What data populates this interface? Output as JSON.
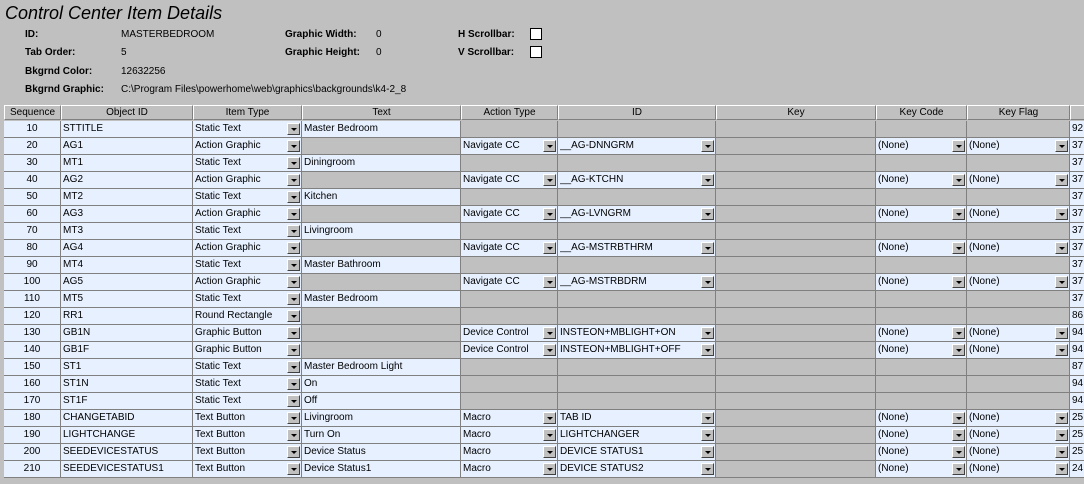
{
  "window": {
    "title": "Control Center Item Details"
  },
  "details": {
    "id_label": "ID:",
    "id_value": "MASTERBEDROOM",
    "tab_order_label": "Tab Order:",
    "tab_order_value": "5",
    "bkgrnd_color_label": "Bkgrnd Color:",
    "bkgrnd_color_value": "12632256",
    "bkgrnd_graphic_label": "Bkgrnd Graphic:",
    "bkgrnd_graphic_value": "C:\\Program Files\\powerhome\\web\\graphics\\backgrounds\\k4-2_8",
    "graphic_width_label": "Graphic Width:",
    "graphic_width_value": "0",
    "graphic_height_label": "Graphic Height:",
    "graphic_height_value": "0",
    "h_scrollbar_label": "H Scrollbar:",
    "h_scrollbar_checked": false,
    "v_scrollbar_label": "V Scrollbar:",
    "v_scrollbar_checked": false
  },
  "table": {
    "columns": [
      "Sequence",
      "Object ID",
      "Item Type",
      "Text",
      "Action Type",
      "ID",
      "Key",
      "Key Code",
      "Key Flag",
      ""
    ],
    "rows": [
      {
        "seq": "10",
        "obj": "STTITLE",
        "type": "Static Text",
        "text": "Master Bedroom",
        "action": "",
        "id": "",
        "key": "",
        "code": "",
        "flag": "",
        "extra": "92"
      },
      {
        "seq": "20",
        "obj": "AG1",
        "type": "Action Graphic",
        "text": "",
        "action": "Navigate CC",
        "id": "__AG-DNNGRM",
        "key": "",
        "code": "(None)",
        "flag": "(None)",
        "extra": "37"
      },
      {
        "seq": "30",
        "obj": "MT1",
        "type": "Static Text",
        "text": "Diningroom",
        "action": "",
        "id": "",
        "key": "",
        "code": "",
        "flag": "",
        "extra": "37"
      },
      {
        "seq": "40",
        "obj": "AG2",
        "type": "Action Graphic",
        "text": "",
        "action": "Navigate CC",
        "id": "__AG-KTCHN",
        "key": "",
        "code": "(None)",
        "flag": "(None)",
        "extra": "37"
      },
      {
        "seq": "50",
        "obj": "MT2",
        "type": "Static Text",
        "text": "Kitchen",
        "action": "",
        "id": "",
        "key": "",
        "code": "",
        "flag": "",
        "extra": "37"
      },
      {
        "seq": "60",
        "obj": "AG3",
        "type": "Action Graphic",
        "text": "",
        "action": "Navigate CC",
        "id": "__AG-LVNGRM",
        "key": "",
        "code": "(None)",
        "flag": "(None)",
        "extra": "37"
      },
      {
        "seq": "70",
        "obj": "MT3",
        "type": "Static Text",
        "text": "Livingroom",
        "action": "",
        "id": "",
        "key": "",
        "code": "",
        "flag": "",
        "extra": "37"
      },
      {
        "seq": "80",
        "obj": "AG4",
        "type": "Action Graphic",
        "text": "",
        "action": "Navigate CC",
        "id": "__AG-MSTRBTHRM",
        "key": "",
        "code": "(None)",
        "flag": "(None)",
        "extra": "37"
      },
      {
        "seq": "90",
        "obj": "MT4",
        "type": "Static Text",
        "text": "Master Bathroom",
        "action": "",
        "id": "",
        "key": "",
        "code": "",
        "flag": "",
        "extra": "37"
      },
      {
        "seq": "100",
        "obj": "AG5",
        "type": "Action Graphic",
        "text": "",
        "action": "Navigate CC",
        "id": "__AG-MSTRBDRM",
        "key": "",
        "code": "(None)",
        "flag": "(None)",
        "extra": "37"
      },
      {
        "seq": "110",
        "obj": "MT5",
        "type": "Static Text",
        "text": "Master Bedroom",
        "action": "",
        "id": "",
        "key": "",
        "code": "",
        "flag": "",
        "extra": "37"
      },
      {
        "seq": "120",
        "obj": "RR1",
        "type": "Round Rectangle",
        "text": "",
        "action": "",
        "id": "",
        "key": "",
        "code": "",
        "flag": "",
        "extra": "86"
      },
      {
        "seq": "130",
        "obj": "GB1N",
        "type": "Graphic Button",
        "text": "",
        "action": "Device Control",
        "id": "INSTEON+MBLIGHT+ON",
        "key": "",
        "code": "(None)",
        "flag": "(None)",
        "extra": "94"
      },
      {
        "seq": "140",
        "obj": "GB1F",
        "type": "Graphic Button",
        "text": "",
        "action": "Device Control",
        "id": "INSTEON+MBLIGHT+OFF",
        "key": "",
        "code": "(None)",
        "flag": "(None)",
        "extra": "94"
      },
      {
        "seq": "150",
        "obj": "ST1",
        "type": "Static Text",
        "text": "Master Bedroom Light",
        "action": "",
        "id": "",
        "key": "",
        "code": "",
        "flag": "",
        "extra": "87"
      },
      {
        "seq": "160",
        "obj": "ST1N",
        "type": "Static Text",
        "text": "On",
        "action": "",
        "id": "",
        "key": "",
        "code": "",
        "flag": "",
        "extra": "94"
      },
      {
        "seq": "170",
        "obj": "ST1F",
        "type": "Static Text",
        "text": "Off",
        "action": "",
        "id": "",
        "key": "",
        "code": "",
        "flag": "",
        "extra": "94"
      },
      {
        "seq": "180",
        "obj": "CHANGETABID",
        "type": "Text Button",
        "text": "Livingroom",
        "action": "Macro",
        "id": "TAB ID",
        "key": "",
        "code": "(None)",
        "flag": "(None)",
        "extra": "25"
      },
      {
        "seq": "190",
        "obj": "LIGHTCHANGE",
        "type": "Text Button",
        "text": "Turn On",
        "action": "Macro",
        "id": "LIGHTCHANGER",
        "key": "",
        "code": "(None)",
        "flag": "(None)",
        "extra": "25"
      },
      {
        "seq": "200",
        "obj": "SEEDEVICESTATUS",
        "type": "Text Button",
        "text": "Device Status",
        "action": "Macro",
        "id": "DEVICE STATUS1",
        "key": "",
        "code": "(None)",
        "flag": "(None)",
        "extra": "25"
      },
      {
        "seq": "210",
        "obj": "SEEDEVICESTATUS1",
        "type": "Text Button",
        "text": "Device Status1",
        "action": "Macro",
        "id": "DEVICE STATUS2",
        "key": "",
        "code": "(None)",
        "flag": "(None)",
        "extra": "24"
      }
    ]
  }
}
